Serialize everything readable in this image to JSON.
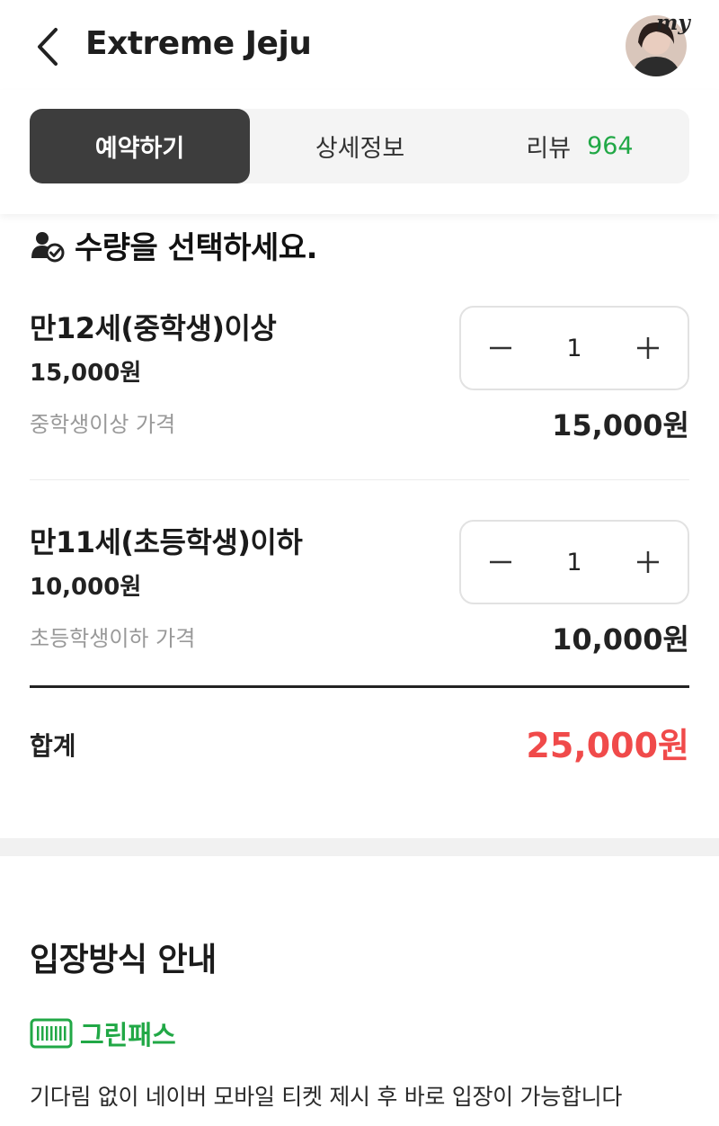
{
  "header": {
    "title": "Extreme Jeju",
    "avatar_badge": "my"
  },
  "tabs": [
    {
      "label": "예약하기",
      "active": true
    },
    {
      "label": "상세정보",
      "active": false
    },
    {
      "label": "리뷰",
      "count": "964",
      "active": false
    }
  ],
  "quantity_section": {
    "title": "수량을 선택하세요.",
    "items": [
      {
        "name": "만12세(중학생)이상",
        "price": "15,000원",
        "description": "중학생이상 가격",
        "quantity": "1",
        "total": "15,000원"
      },
      {
        "name": "만11세(초등학생)이하",
        "price": "10,000원",
        "description": "초등학생이하 가격",
        "quantity": "1",
        "total": "10,000원"
      }
    ],
    "sum_label": "합계",
    "sum_value": "25,000원"
  },
  "entry_guide": {
    "title": "입장방식 안내",
    "pass_label": "그린패스",
    "description": "기다림 없이 네이버 모바일 티켓 제시 후 바로 입장이 가능합니다"
  },
  "colors": {
    "accent_green": "#21a846",
    "total_red": "#f04a4a",
    "active_tab": "#3d3d3d"
  }
}
